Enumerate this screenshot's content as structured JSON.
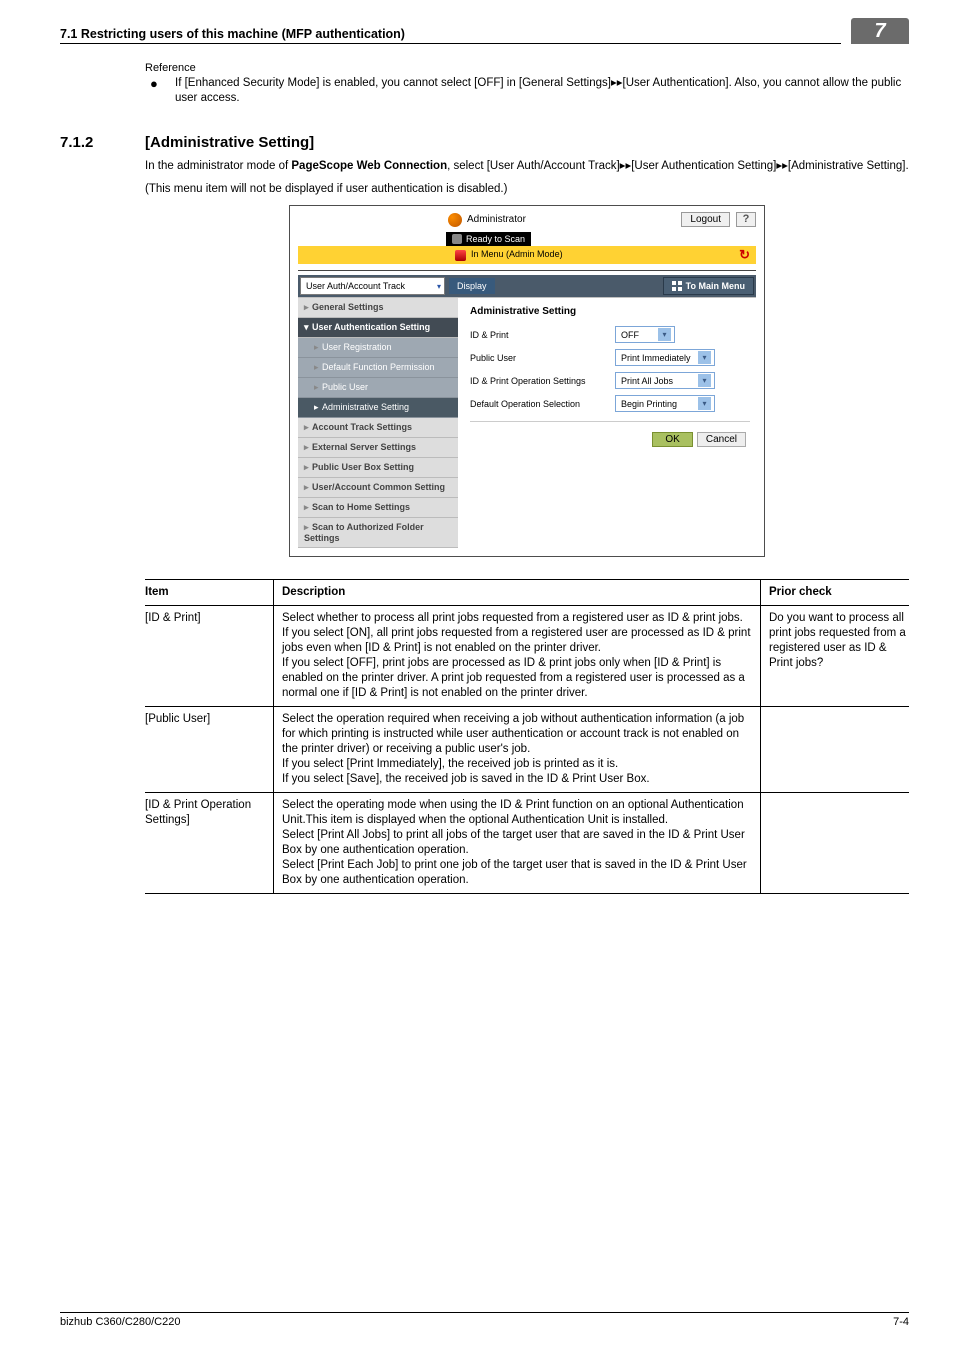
{
  "header": {
    "section_number_title": "7.1    Restricting users of this machine (MFP authentication)",
    "chapter_number": "7"
  },
  "reference": {
    "label": "Reference",
    "bullet": "If [Enhanced Security Mode] is enabled, you cannot select [OFF] in [General Settings]▸▸[User Authentication]. Also, you cannot allow the public user access."
  },
  "section": {
    "num": "7.1.2",
    "title": "[Administrative Setting]",
    "para1": "In the administrator mode of PageScope Web Connection, select [User Auth/Account Track]▸▸[User Authentication Setting]▸▸[Administrative Setting].",
    "para2": "(This menu item will not be displayed if user authentication is disabled.)"
  },
  "shot": {
    "admin_label": "Administrator",
    "logout": "Logout",
    "ready": "Ready to Scan",
    "in_menu": "In Menu (Admin Mode)",
    "dropdown": "User Auth/Account Track",
    "display_btn": "Display",
    "main_menu": "To Main Menu",
    "side_items": [
      "General Settings",
      "User Authentication Setting",
      "User Registration",
      "Default Function Permission",
      "Public User",
      "Administrative Setting",
      "Account Track Settings",
      "External Server Settings",
      "Public User Box Setting",
      "User/Account Common Setting",
      "Scan to Home Settings",
      "Scan to Authorized Folder Settings"
    ],
    "pane_title": "Administrative Setting",
    "rows": [
      {
        "label": "ID & Print",
        "value": "OFF"
      },
      {
        "label": "Public User",
        "value": "Print Immediately"
      },
      {
        "label": "ID & Print Operation Settings",
        "value": "Print All Jobs"
      },
      {
        "label": "Default Operation Selection",
        "value": "Begin Printing"
      }
    ],
    "ok": "OK",
    "cancel": "Cancel"
  },
  "table": {
    "head": {
      "item": "Item",
      "desc": "Description",
      "prior": "Prior check"
    },
    "rows": [
      {
        "item": "[ID & Print]",
        "desc": "Select whether to process all print jobs requested from a registered user as ID & print jobs.\nIf you select [ON], all print jobs requested from a registered user are processed as ID & print jobs even when [ID & Print] is not enabled on the printer driver.\nIf you select [OFF], print jobs are processed as ID & print jobs only when [ID & Print] is enabled on the printer driver. A print job requested from a registered user is processed as a normal one if [ID & Print] is not enabled on the printer driver.",
        "prior": "Do you want to process all print jobs requested from a registered user as ID & Print jobs?"
      },
      {
        "item": "[Public User]",
        "desc": "Select the operation required when receiving a job without authentication information (a job for which printing is instructed while user authentication or account track is not enabled on the printer driver) or receiving a public user's job.\nIf you select [Print Immediately], the received job is printed as it is.\nIf you select [Save], the received job is saved in the ID & Print User Box.",
        "prior": ""
      },
      {
        "item": "[ID & Print Operation Settings]",
        "desc": "Select the operating mode when using the ID & Print function on an optional Authentication Unit.This item is displayed when the optional Authentication Unit is installed.\nSelect  [Print All Jobs] to print all jobs of the target user that are saved in the ID & Print User Box by one authentication operation.\nSelect [Print Each Job] to print one job of the target user that is saved in the ID & Print User Box by one authentication operation.",
        "prior": ""
      }
    ]
  },
  "footer": {
    "left": "bizhub C360/C280/C220",
    "right": "7-4"
  }
}
